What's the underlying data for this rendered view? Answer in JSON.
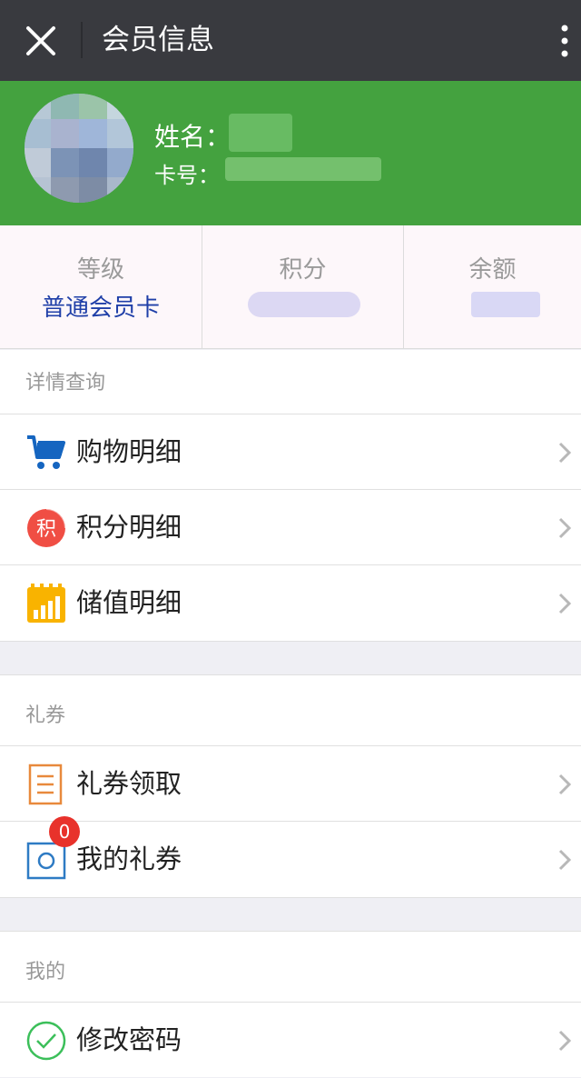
{
  "topbar": {
    "title": "会员信息",
    "close_icon": "close-icon",
    "more_icon": "more-vertical-icon"
  },
  "profile": {
    "name_label": "姓名：",
    "card_label": "卡号：",
    "colors": {
      "background": "#44a23f"
    }
  },
  "stats": [
    {
      "label": "等级",
      "value": "普通会员卡"
    },
    {
      "label": "积分",
      "value": ""
    },
    {
      "label": "余额",
      "value": ""
    }
  ],
  "details": {
    "title": "详情查询",
    "items": [
      {
        "label": "购物明细",
        "icon": "shopping-cart-icon"
      },
      {
        "label": "积分明细",
        "icon": "points-icon",
        "icon_text": "积"
      },
      {
        "label": "储值明细",
        "icon": "stored-value-icon"
      }
    ]
  },
  "coupons": {
    "title": "礼券",
    "items": [
      {
        "label": "礼券领取",
        "icon": "coupon-receive-icon"
      },
      {
        "label": "我的礼券",
        "icon": "my-coupon-icon",
        "badge": "0"
      }
    ]
  },
  "mine": {
    "title": "我的",
    "items": [
      {
        "label": "修改密码",
        "icon": "check-circle-icon"
      }
    ]
  }
}
